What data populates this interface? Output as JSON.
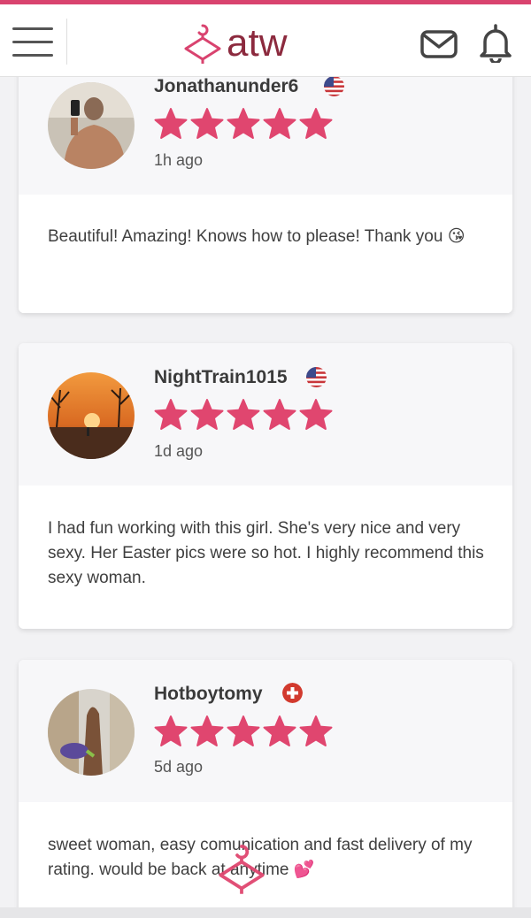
{
  "header": {
    "logo_text": "atw",
    "icons": [
      "menu-icon",
      "hanger-logo-icon",
      "mail-icon",
      "bell-icon"
    ],
    "accent_color": "#d9436f",
    "logo_color": "#8c2a3e"
  },
  "reviews": [
    {
      "username": "Jonathanunder6",
      "flag": "us-flag-icon",
      "rating": 5,
      "time": "1h ago",
      "text": "Beautiful! Amazing! Knows how to please! Thank you 😘"
    },
    {
      "username": "NightTrain1015",
      "flag": "us-flag-icon",
      "rating": 5,
      "time": "1d ago",
      "text": "I had fun working with this girl. She's very nice and very sexy. Her Easter pics were so hot. I highly recommend this sexy woman."
    },
    {
      "username": "Hotboytomy",
      "flag": "swiss-flag-icon",
      "rating": 5,
      "time": "5d ago",
      "text": "sweet woman, easy comunication and fast delivery of my rating. would be back at anytime 💕"
    }
  ],
  "star_color": "#e0466f"
}
